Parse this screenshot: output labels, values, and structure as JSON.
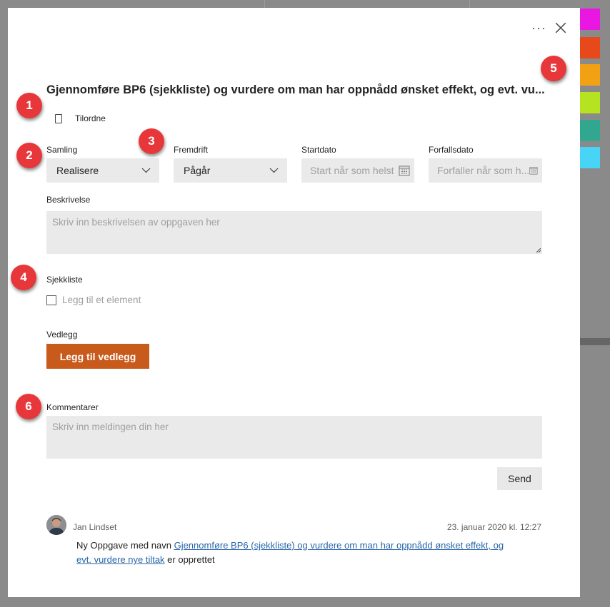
{
  "colors": {
    "accent": "#c85a1b",
    "marker": "#e8373a",
    "link": "#2765a8",
    "swatches": [
      "#ea17e2",
      "#e8491b",
      "#f2a115",
      "#b5e31f",
      "#31a78f",
      "#48d5f5"
    ]
  },
  "header": {
    "more_label": "···",
    "close_icon": "close-icon",
    "title": "Gjennomføre BP6 (sjekkliste) og vurdere om man har oppnådd ønsket effekt, og evt. vu..."
  },
  "assign": {
    "label": "Tilordne",
    "icon": "person-icon"
  },
  "fields": {
    "bucket": {
      "label": "Samling",
      "value": "Realisere"
    },
    "progress": {
      "label": "Fremdrift",
      "value": "Pågår"
    },
    "start": {
      "label": "Startdato",
      "placeholder": "Start når som helst"
    },
    "due": {
      "label": "Forfallsdato",
      "placeholder": "Forfaller når som h..."
    }
  },
  "description": {
    "label": "Beskrivelse",
    "placeholder": "Skriv inn beskrivelsen av oppgaven her"
  },
  "checklist": {
    "label": "Sjekkliste",
    "placeholder": "Legg til et element"
  },
  "attachments": {
    "label": "Vedlegg",
    "button": "Legg til vedlegg"
  },
  "comments": {
    "label": "Kommentarer",
    "placeholder": "Skriv inn meldingen din her",
    "send": "Send",
    "items": [
      {
        "author": "Jan Lindset",
        "date": "23. januar 2020 kl. 12:27",
        "text_before": "Ny Oppgave med navn ",
        "link_line1": "Gjennomføre BP6 (sjekkliste) og vurdere om man har oppnådd ønsket effekt, og",
        "link_line2": "evt. vurdere nye tiltak",
        "text_after": " er opprettet"
      }
    ]
  },
  "markers": [
    "1",
    "2",
    "3",
    "4",
    "5",
    "6"
  ]
}
